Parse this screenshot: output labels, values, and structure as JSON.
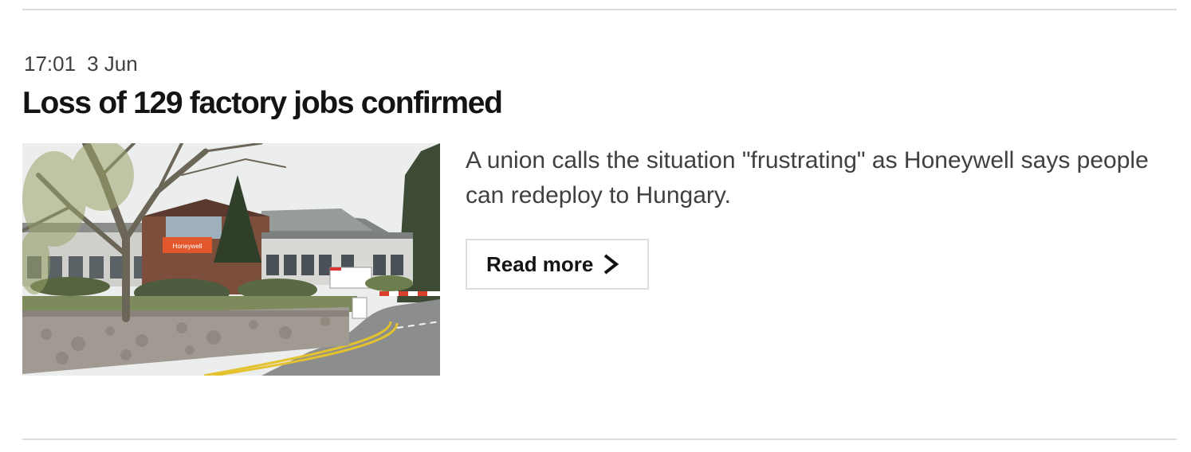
{
  "story": {
    "time": "17:01",
    "date": "3 Jun",
    "headline": "Loss of 129 factory jobs confirmed",
    "summary": "A union calls the situation \"frustrating\" as Honeywell says people can redeploy to Hungary.",
    "read_more_label": "Read more",
    "read_more_icon": "chevron-right-icon",
    "image": {
      "description_icon": "factory-photo",
      "sign_text": "Honeywell"
    }
  },
  "colors": {
    "divider": "#dcdcdc",
    "headline": "#141414",
    "body_text": "#404040",
    "sign_orange": "#e2572b"
  }
}
